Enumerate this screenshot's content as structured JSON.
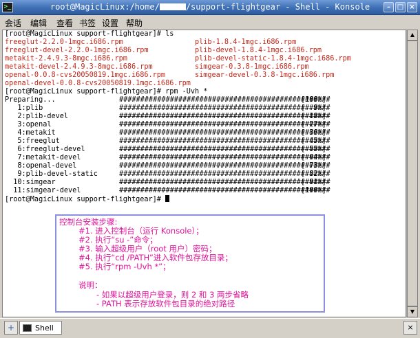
{
  "window": {
    "title_prefix": "root@MagicLinux:/home/",
    "title_suffix": "/support-flightgear - Shell - Konsole",
    "buttons": {
      "minimize": "–",
      "maximize": "□",
      "close": "×"
    }
  },
  "menu": [
    "会话",
    "编辑",
    "查看",
    "书签",
    "设置",
    "帮助"
  ],
  "terminal": {
    "prompt_ls": "[root@MagicLinux support-flightgear]# ls",
    "files": [
      [
        "freeglut-2.2.0-1mgc.i686.rpm",
        "plib-1.8.4-1mgc.i686.rpm"
      ],
      [
        "freeglut-devel-2.2.0-1mgc.i686.rpm",
        "plib-devel-1.8.4-1mgc.i686.rpm"
      ],
      [
        "metakit-2.4.9.3-8mgc.i686.rpm",
        "plib-devel-static-1.8.4-1mgc.i686.rpm"
      ],
      [
        "metakit-devel-2.4.9.3-8mgc.i686.rpm",
        "simgear-0.3.8-1mgc.i686.rpm"
      ],
      [
        "openal-0.0.8-cvs20050819.1mgc.i686.rpm",
        "simgear-devel-0.3.8-1mgc.i686.rpm"
      ],
      [
        "openal-devel-0.0.8-cvs20050819.1mgc.i686.rpm",
        ""
      ]
    ],
    "prompt_rpm": "[root@MagicLinux support-flightgear]# rpm -Uvh *",
    "progress_bar": "##################################################",
    "progress": [
      [
        "Preparing...",
        "[100%]"
      ],
      [
        "   1:plib",
        "[  9%]"
      ],
      [
        "   2:plib-devel",
        "[ 18%]"
      ],
      [
        "   3:openal",
        "[ 27%]"
      ],
      [
        "   4:metakit",
        "[ 36%]"
      ],
      [
        "   5:freeglut",
        "[ 45%]"
      ],
      [
        "   6:freeglut-devel",
        "[ 55%]"
      ],
      [
        "   7:metakit-devel",
        "[ 64%]"
      ],
      [
        "   8:openal-devel",
        "[ 73%]"
      ],
      [
        "   9:plib-devel-static",
        "[ 82%]"
      ],
      [
        "  10:simgear",
        "[ 91%]"
      ],
      [
        "  11:simgear-devel",
        "[100%]"
      ]
    ],
    "prompt_final": "[root@MagicLinux support-flightgear]# "
  },
  "note": {
    "title": "控制台安装步骤:",
    "steps": [
      "#1. 进入控制台（运行 Konsole）；",
      "#2. 执行“su -”命令；",
      "#3. 输入超级用户（root 用户）密码；",
      "#4. 执行“cd /PATH”进入软件包存放目录；",
      "#5. 执行“rpm -Uvh *”；"
    ],
    "explain_title": "说明：",
    "bullets": [
      "- 如果以超级用户登录，则 2 和 3 两步省略",
      "- PATH 表示存放软件包目录的绝对路径"
    ],
    "color": "#e0139a"
  },
  "tabbar": {
    "new_tab": "+",
    "tab_label": "Shell",
    "close_tab": "×"
  },
  "colors": {
    "file_names": "#c0281c",
    "titlebar": "#3d6fb5",
    "note_border": "#8c8ee0"
  }
}
